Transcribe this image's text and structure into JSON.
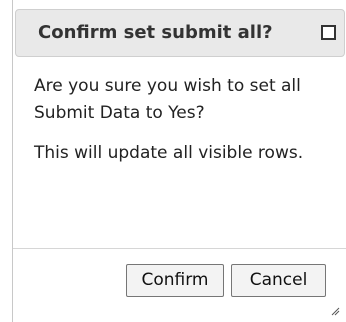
{
  "dialog": {
    "title": "Confirm set submit all?",
    "message": "Are you sure you wish to set all Submit Data to Yes?",
    "note": "This will update all visible rows.",
    "confirm_label": "Confirm",
    "cancel_label": "Cancel"
  },
  "icons": {
    "close": "close-icon",
    "resize": "resize-grip-icon"
  },
  "colors": {
    "titlebar_bg": "#e9e9e9",
    "title_text": "#333333",
    "button_bg": "#f3f3f3"
  }
}
